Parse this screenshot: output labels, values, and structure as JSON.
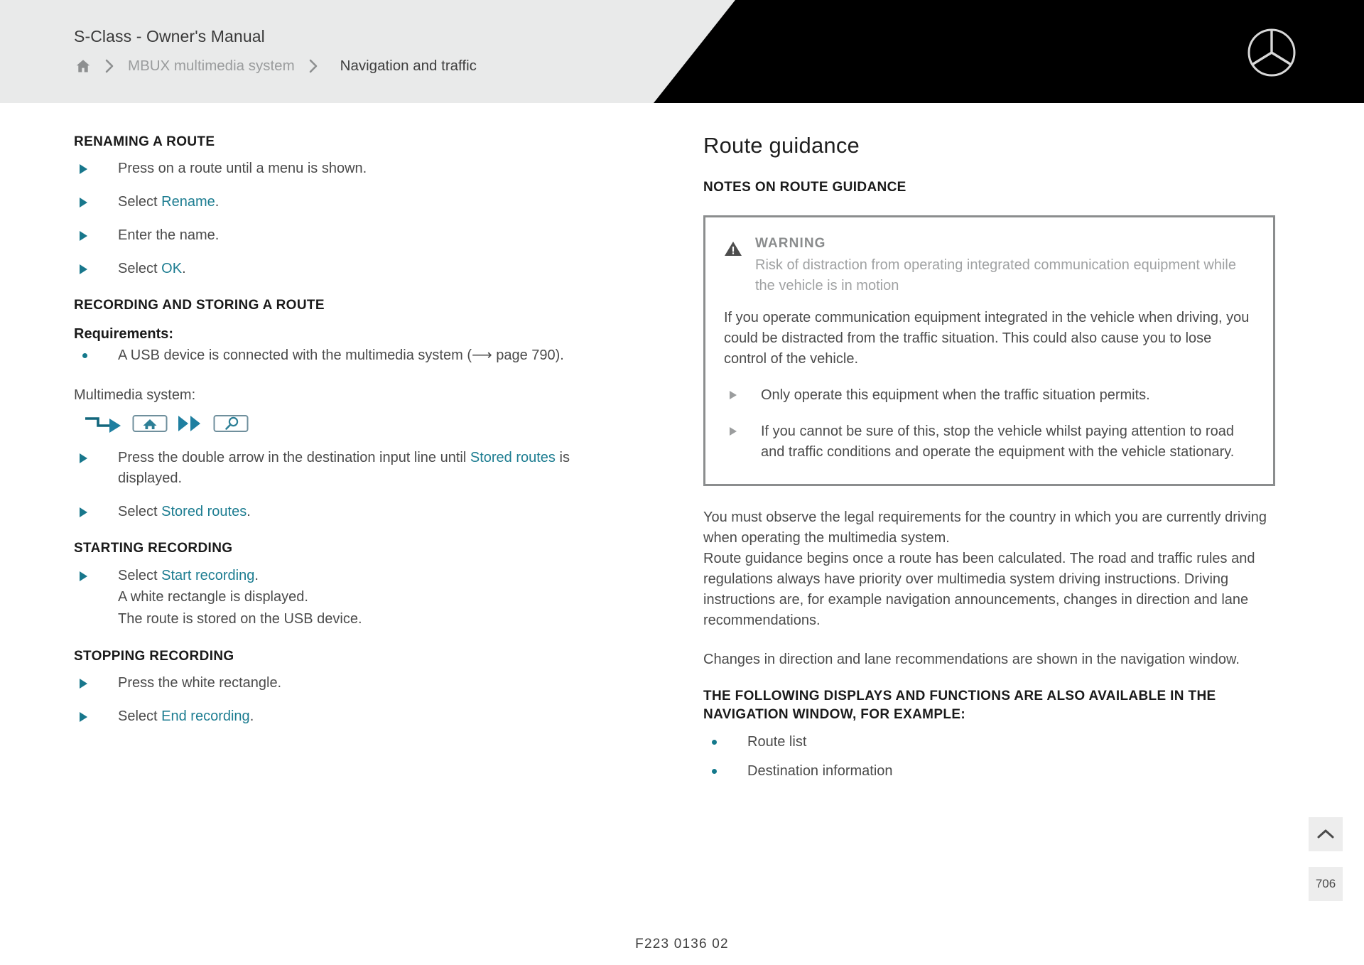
{
  "header": {
    "manual_title": "S-Class - Owner's Manual",
    "breadcrumb": {
      "home_icon": "home-icon",
      "separator_icon": "chevron-right-icon",
      "items": [
        {
          "label": "MBUX multimedia system",
          "current": false
        },
        {
          "label": "Navigation and traffic",
          "current": true
        }
      ]
    },
    "brand_logo": "mercedes-benz-star-logo"
  },
  "left_column": {
    "sections": [
      {
        "heading": "RENAMING A ROUTE",
        "steps": [
          {
            "prefix": "Press on a route until a menu is shown.",
            "ref": "",
            "suffix": ""
          },
          {
            "prefix": "Select ",
            "ref": "Rename",
            "suffix": "."
          },
          {
            "prefix": "Enter the name.",
            "ref": "",
            "suffix": ""
          },
          {
            "prefix": "Select ",
            "ref": "OK",
            "suffix": "."
          }
        ]
      },
      {
        "heading": "RECORDING AND STORING A ROUTE",
        "requirements_label": "Requirements:",
        "requirements": [
          "A USB device is connected with the multimedia system (⟶ page 790)."
        ],
        "lead_in": "Multimedia system:",
        "icon_sequence": [
          "stepped-arrow-icon",
          "home-in-frame-icon",
          "double-chevron-icon",
          "magnifier-in-frame-icon"
        ],
        "steps": [
          {
            "prefix": "Press the double arrow in the destination input line until ",
            "ref": "Stored routes",
            "suffix": " is displayed."
          },
          {
            "prefix": "Select ",
            "ref": "Stored routes",
            "suffix": "."
          }
        ]
      },
      {
        "heading": "STARTING RECORDING",
        "steps": [
          {
            "prefix": "Select ",
            "ref": "Start recording",
            "suffix": "."
          }
        ],
        "results": [
          "A white rectangle is displayed.",
          "The route is stored on the USB device."
        ]
      },
      {
        "heading": "STOPPING RECORDING",
        "steps": [
          {
            "prefix": "Press the white rectangle.",
            "ref": "",
            "suffix": ""
          },
          {
            "prefix": "Select ",
            "ref": "End recording",
            "suffix": "."
          }
        ]
      }
    ]
  },
  "right_column": {
    "title": "Route guidance",
    "subheading": "NOTES ON ROUTE GUIDANCE",
    "warning": {
      "icon": "warning-triangle-icon",
      "label": "WARNING",
      "subtitle": "Risk of distraction from operating integrated communication equipment while the vehicle is in motion",
      "body": "If you operate communication equipment integrated in the vehicle when driving, you could be distracted from the traffic situation. This could also cause you to lose control of the vehicle.",
      "actions": [
        "Only operate this equipment when the traffic situation permits.",
        "If you cannot be sure of this, stop the vehicle whilst paying attention to road and traffic conditions and operate the equipment with the vehicle stationary."
      ]
    },
    "paragraphs": [
      "You must observe the legal requirements for the country in which you are currently driving when operating the multimedia system.\nRoute guidance begins once a route has been calculated. The road and traffic rules and regulations always have priority over multimedia system driving instructions. Driving instructions are, for example navigation announcements, changes in direction and lane recommendations.",
      "Changes in direction and lane recommendations are shown in the navigation window."
    ],
    "list_heading": "THE FOLLOWING DISPLAYS AND FUNCTIONS ARE ALSO AVAILABLE IN THE NAVIGATION WINDOW, FOR EXAMPLE:",
    "list_items": [
      "Route list",
      "Destination information"
    ]
  },
  "controls": {
    "scroll_top_icon": "chevron-up-icon",
    "page_number": "706"
  },
  "footer": {
    "document_code": "F223 0136 02"
  },
  "colors": {
    "accent_teal": "#1d7d91",
    "header_bg": "#e9eaea",
    "warning_border": "#8b8d8e",
    "body_text": "#4b4b4b"
  }
}
